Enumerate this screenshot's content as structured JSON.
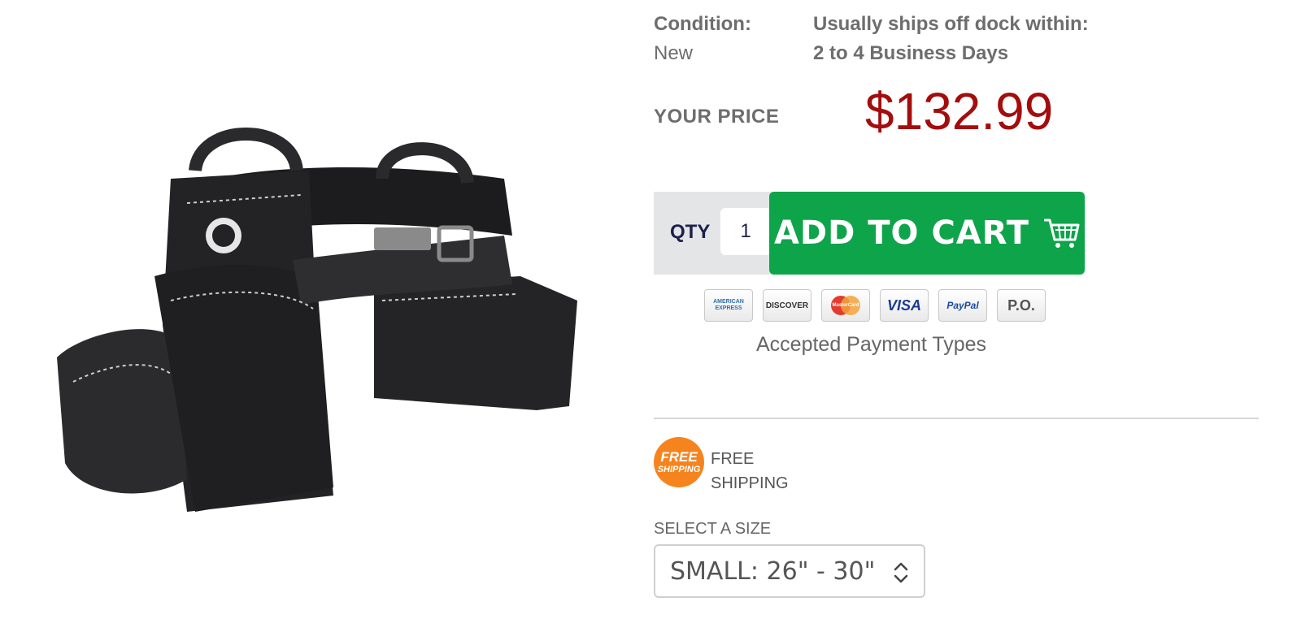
{
  "condition": {
    "label": "Condition:",
    "value": "New"
  },
  "shipping": {
    "label": "Usually ships off dock within:",
    "value": "2 to 4 Business Days"
  },
  "price": {
    "label": "YOUR PRICE",
    "value": "$132.99",
    "color": "#a30d0d"
  },
  "cart": {
    "qty_label": "QTY",
    "qty_value": "1",
    "button_label": "ADD TO CART",
    "button_color": "#0ea44a"
  },
  "payment": {
    "cards": [
      {
        "label": "AMERICAN EXPRESS",
        "icon": "amex-icon"
      },
      {
        "label": "DISCOVER",
        "icon": "discover-icon"
      },
      {
        "label": "MasterCard",
        "icon": "mastercard-icon"
      },
      {
        "label": "VISA",
        "icon": "visa-icon"
      },
      {
        "label": "PayPal",
        "icon": "paypal-icon"
      },
      {
        "label": "P.O.",
        "icon": "purchase-order-icon"
      }
    ],
    "caption": "Accepted Payment Types"
  },
  "free_shipping": {
    "badge_line1": "FREE",
    "badge_line2": "SHIPPING",
    "line1": "FREE",
    "line2": "SHIPPING",
    "badge_color": "#f5841f"
  },
  "size": {
    "label": "SELECT A SIZE",
    "selected": "SMALL: 26\" - 30\""
  },
  "product_image": {
    "icon": "tool-belt-product-image"
  }
}
